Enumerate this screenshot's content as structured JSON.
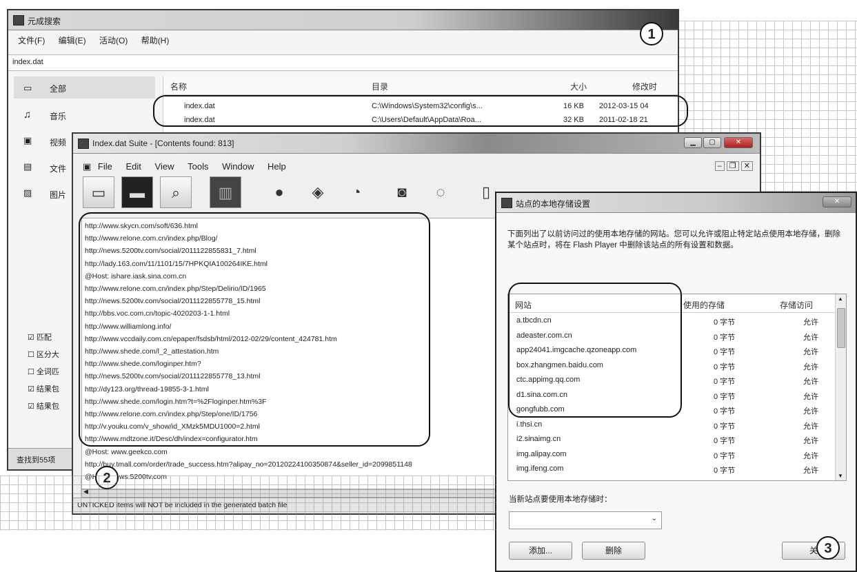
{
  "search_window": {
    "title": "元成搜索",
    "menu": [
      "文件(F)",
      "编辑(E)",
      "活动(O)",
      "帮助(H)"
    ],
    "query": "index.dat",
    "sidebar": [
      "全部",
      "音乐",
      "视频",
      "文件",
      "图片"
    ],
    "checkboxes": [
      {
        "label": "匹配",
        "checked": true
      },
      {
        "label": "区分大",
        "checked": false
      },
      {
        "label": "全词匹",
        "checked": false
      },
      {
        "label": "结果包",
        "checked": true
      },
      {
        "label": "结果包",
        "checked": true
      }
    ],
    "status": "查找到55项",
    "columns": [
      "名称",
      "目录",
      "大小",
      "修改时"
    ],
    "rows": [
      {
        "name": "index.dat",
        "dir": "C:\\Windows\\System32\\config\\s...",
        "size": "16 KB",
        "date": "2012-03-15 04"
      },
      {
        "name": "index.dat",
        "dir": "C:\\Users\\Default\\AppData\\Roa...",
        "size": "32 KB",
        "date": "2011-02-18 21"
      }
    ]
  },
  "suite_window": {
    "title": "Index.dat Suite - [Contents found: 813]",
    "menu": [
      "File",
      "Edit",
      "View",
      "Tools",
      "Window",
      "Help"
    ],
    "urls": [
      "http://www.skycn.com/soft/636.html",
      "http://www.relone.com.cn/index.php/Blog/",
      "http://news.5200tv.com/social/2011122855831_7.html",
      "http://lady.163.com/11/1101/15/7HPKQIA100264IKE.html",
      "@Host: ishare.iask.sina.com.cn",
      "http://www.relone.com.cn/index.php/Step/Delirio/ID/1965",
      "http://news.5200tv.com/social/2011122855778_15.html",
      "http://bbs.voc.com.cn/topic-4020203-1-1.html",
      "http://www.williamlong.info/",
      "http://www.vccdaily.com.cn/epaper/fsdsb/html/2012-02/29/content_424781.htm",
      "http://www.shede.com/l_2_attestation.htm",
      "http://www.shede.com/loginper.htm?",
      "http://news.5200tv.com/social/2011122855778_13.html",
      "http://dy123.org/thread-19855-3-1.html",
      "http://www.shede.com/login.htm?t=%2Floginper.htm%3F",
      "http://www.relone.com.cn/index.php/Step/one/ID/1756",
      "http://v.youku.com/v_show/id_XMzk5MDU1000=2.html",
      "http://www.mdtzone.it/Desc/dh/index=configurator.htm",
      "@Host: www.geekco.com",
      "http://buy.tmall.com/order/trade_success.htm?alipay_no=20120224100350874&seller_id=2099851148",
      "@Host: news.5200tv.com"
    ],
    "status": "UNTICKED items will NOT be included in the generated batch file"
  },
  "flash_dialog": {
    "title": "站点的本地存储设置",
    "description": "下面列出了以前访问过的使用本地存储的网站。您可以允许或阻止特定站点使用本地存储，删除某个站点时，将在 Flash Player 中删除该站点的所有设置和数据。",
    "columns": [
      "网站",
      "使用的存储",
      "存储访问"
    ],
    "sites": [
      {
        "site": "a.tbcdn.cn",
        "used": "0 字节",
        "access": "允许"
      },
      {
        "site": "adeaster.com.cn",
        "used": "0 字节",
        "access": "允许"
      },
      {
        "site": "app24041.imgcache.qzoneapp.com",
        "used": "0 字节",
        "access": "允许"
      },
      {
        "site": "box.zhangmen.baidu.com",
        "used": "0 字节",
        "access": "允许"
      },
      {
        "site": "ctc.appimg.qq.com",
        "used": "0 字节",
        "access": "允许"
      },
      {
        "site": "d1.sina.com.cn",
        "used": "0 字节",
        "access": "允许"
      },
      {
        "site": "gongfubb.com",
        "used": "0 字节",
        "access": "允许"
      },
      {
        "site": "i.thsi.cn",
        "used": "0 字节",
        "access": "允许"
      },
      {
        "site": "i2.sinaimg.cn",
        "used": "0 字节",
        "access": "允许"
      },
      {
        "site": "img.alipay.com",
        "used": "0 字节",
        "access": "允许"
      },
      {
        "site": "img.ifeng.com",
        "used": "0 字节",
        "access": "允许"
      }
    ],
    "prompt": "当新站点要使用本地存储时：",
    "add_label": "添加...",
    "remove_label": "删除",
    "close_label": "关"
  },
  "badges": [
    "1",
    "2",
    "3"
  ]
}
